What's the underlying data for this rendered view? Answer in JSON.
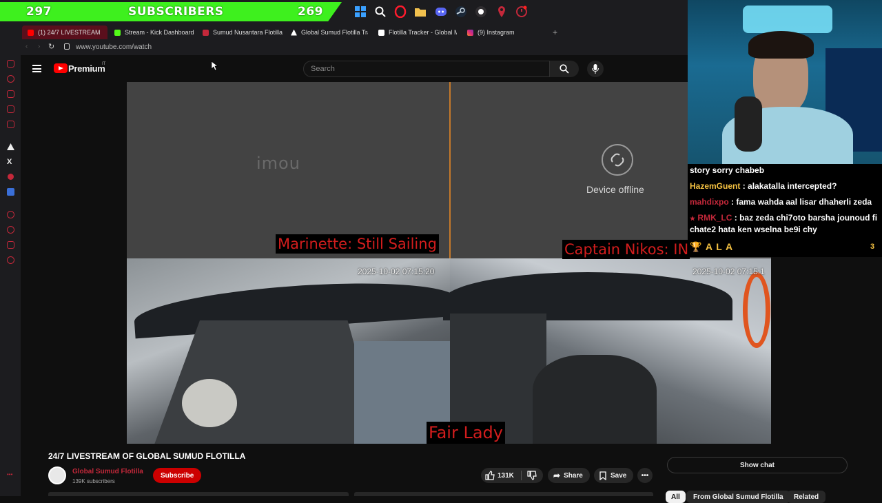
{
  "overlay": {
    "sub_count_left": "297",
    "sub_label": "SUBSCRIBERS",
    "sub_count_right": "269",
    "banner_color": "#3ef01e"
  },
  "taskbar_icons": [
    "windows-icon",
    "search-icon",
    "opera-icon",
    "folder-icon",
    "discord-icon",
    "steam-icon",
    "obs-icon",
    "pin-icon",
    "clock-icon"
  ],
  "browser": {
    "tabs": [
      {
        "label": "(1) 24/7 LIVESTREAM",
        "color": "#ff0000"
      },
      {
        "label": "Stream - Kick Dashboard",
        "color": "#53fc18"
      },
      {
        "label": "Sumud Nusantara Flotilla",
        "color": "#c4283a"
      },
      {
        "label": "Global Sumud Flotilla Tra",
        "color": "#ffffff"
      },
      {
        "label": "Flotilla Tracker - Global M",
        "color": "#ffffff"
      },
      {
        "label": "(9) Instagram",
        "color": "#e1306c"
      }
    ],
    "new_tab": "+",
    "url": "www.youtube.com/watch"
  },
  "youtube": {
    "logo_text": "Premium",
    "logo_sup": "IT",
    "search_placeholder": "Search"
  },
  "video": {
    "brand_watermark": "imou",
    "offline_text": "Device offline",
    "label_marinette": "Marinette: Still Sailing",
    "label_nikos": "Captain Nikos: INT",
    "label_fairlady": "Fair Lady",
    "timestamp_left": "2025-10-02 07:15:20",
    "timestamp_right": "2025-10-02 07:15:1"
  },
  "chat": {
    "messages": [
      {
        "user": "",
        "text": "story sorry chabeb",
        "color": "#ffffff"
      },
      {
        "user": "HazemGuent",
        "text": ": alakatalla intercepted?",
        "color": "#f5c242"
      },
      {
        "user": "mahdixpo",
        "text": ": fama wahda aal lisar dhaherli zeda",
        "color": "#c4283a"
      },
      {
        "user": "RMK_LC",
        "text": ": baz zeda chi7oto barsha jounoud fi chate2 hata ken wselna be9i chy",
        "color": "#c4283a"
      }
    ],
    "footer_name": "A L A",
    "footer_count": "3"
  },
  "watch": {
    "title": "24/7 LIVESTREAM OF GLOBAL SUMUD FLOTILLA",
    "channel_name": "Global Sumud Flotilla",
    "subscribers": "139K subscribers",
    "subscribe_label": "Subscribe",
    "likes": "131K",
    "share_label": "Share",
    "save_label": "Save",
    "show_chat_label": "Show chat",
    "chips": [
      "All",
      "From Global Sumud Flotilla",
      "Related"
    ]
  }
}
